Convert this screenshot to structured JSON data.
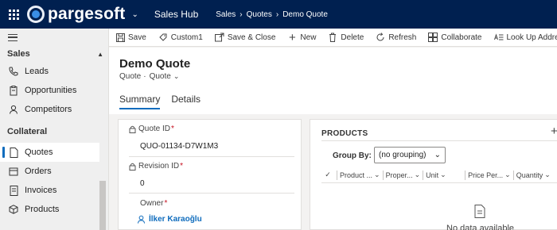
{
  "topbar": {
    "logo_text": "pargesoft",
    "app_name": "Sales Hub",
    "breadcrumbs": [
      "Sales",
      "Quotes",
      "Demo Quote"
    ]
  },
  "nav": {
    "group_sales": "Sales",
    "sales_items": [
      {
        "label": "Leads",
        "icon": "phone-icon"
      },
      {
        "label": "Opportunities",
        "icon": "clipboard-icon"
      },
      {
        "label": "Competitors",
        "icon": "person-icon"
      }
    ],
    "group_collateral": "Collateral",
    "collateral_items": [
      {
        "label": "Quotes",
        "icon": "document-icon",
        "active": true
      },
      {
        "label": "Orders",
        "icon": "box-icon"
      },
      {
        "label": "Invoices",
        "icon": "invoice-icon"
      },
      {
        "label": "Products",
        "icon": "cube-icon"
      }
    ]
  },
  "commands": [
    {
      "label": "Save",
      "icon": "save-icon"
    },
    {
      "label": "Custom1",
      "icon": "custom-icon"
    },
    {
      "label": "Save & Close",
      "icon": "save-close-icon"
    },
    {
      "label": "New",
      "icon": "plus-icon"
    },
    {
      "label": "Delete",
      "icon": "trash-icon"
    },
    {
      "label": "Refresh",
      "icon": "refresh-icon"
    },
    {
      "label": "Collaborate",
      "icon": "collaborate-icon"
    },
    {
      "label": "Look Up Address",
      "icon": "address-icon"
    }
  ],
  "header": {
    "title": "Demo Quote",
    "entity": "Quote",
    "form_selector": "Quote",
    "tabs": [
      "Summary",
      "Details"
    ]
  },
  "form": {
    "quote_id_label": "Quote ID",
    "quote_id_value": "QUO-01134-D7W1M3",
    "revision_label": "Revision ID",
    "revision_value": "0",
    "owner_label": "Owner",
    "owner_value": "İlker Karaoğlu"
  },
  "products": {
    "title": "PRODUCTS",
    "group_by_label": "Group By:",
    "group_by_value": "(no grouping)",
    "columns": [
      "Product ...",
      "Proper...",
      "Unit",
      "Price Per...",
      "Quantity"
    ],
    "empty_text": "No data available"
  },
  "colors": {
    "topbar": "#002050",
    "accent": "#0f6cbd",
    "required": "#c50f1f"
  }
}
